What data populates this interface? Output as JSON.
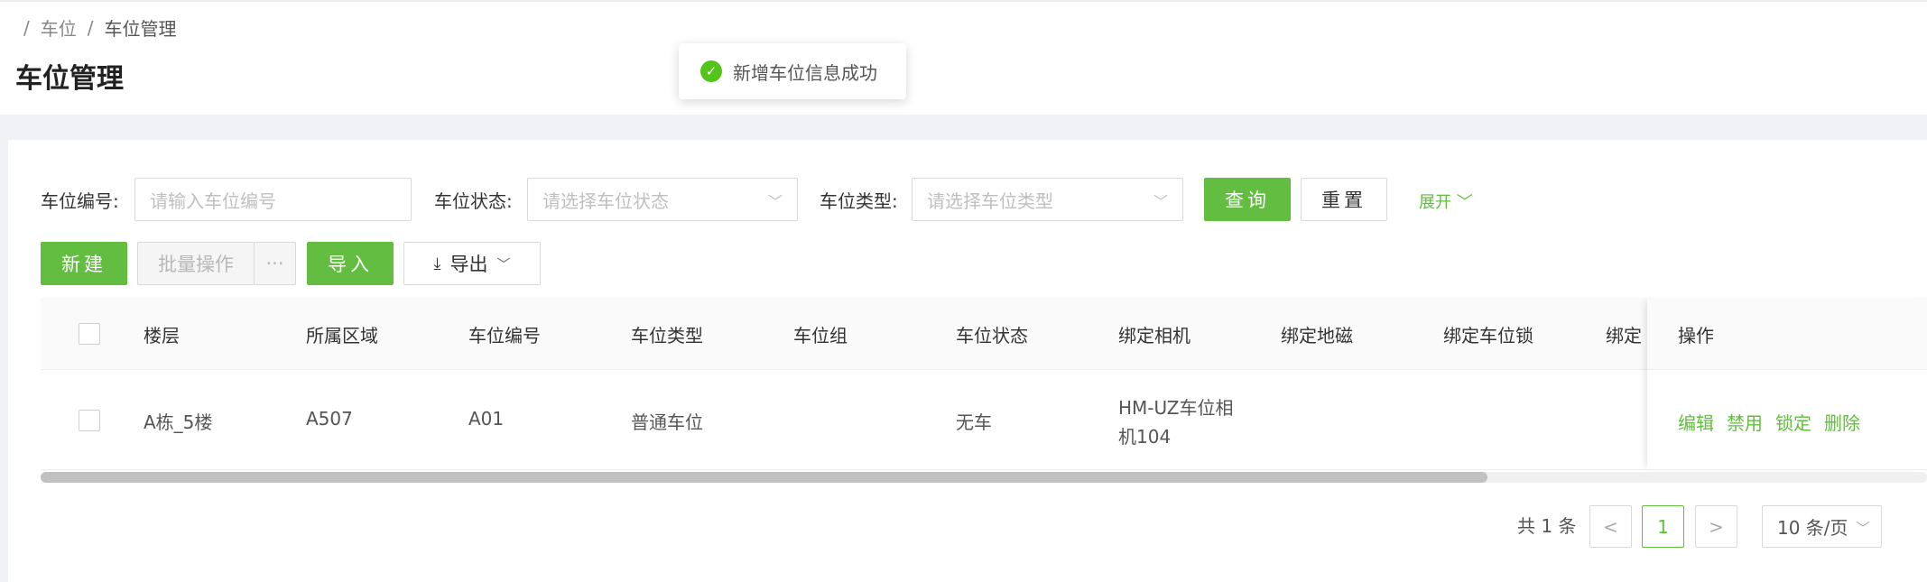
{
  "breadcrumb": {
    "sep": "/",
    "items": [
      "车位",
      "车位管理"
    ]
  },
  "page_title": "车位管理",
  "toast": {
    "message": "新增车位信息成功",
    "icon": "check-circle-icon"
  },
  "filters": {
    "spot_no": {
      "label": "车位编号:",
      "placeholder": "请输入车位编号"
    },
    "status": {
      "label": "车位状态:",
      "placeholder": "请选择车位状态"
    },
    "type": {
      "label": "车位类型:",
      "placeholder": "请选择车位类型"
    },
    "query_label": "查询",
    "reset_label": "重置",
    "expand_label": "展开"
  },
  "toolbar": {
    "new_label": "新建",
    "batch_label": "批量操作",
    "more_label": "···",
    "import_label": "导入",
    "export_label": "导出"
  },
  "table": {
    "columns": [
      "楼层",
      "所属区域",
      "车位编号",
      "车位类型",
      "车位组",
      "车位状态",
      "绑定相机",
      "绑定地磁",
      "绑定车位锁",
      "绑定",
      "操作"
    ],
    "rows": [
      {
        "floor": "A栋_5楼",
        "area": "A507",
        "spot_no": "A01",
        "type": "普通车位",
        "group": "",
        "status": "无车",
        "camera_line1": "HM-UZ车位相",
        "camera_line2": "机104",
        "magnet": "",
        "lock": ""
      }
    ],
    "actions": [
      "编辑",
      "禁用",
      "锁定",
      "删除"
    ]
  },
  "pagination": {
    "total": "共 1 条",
    "prev": "<",
    "current": "1",
    "next": ">",
    "page_size": "10 条/页"
  },
  "colors": {
    "primary": "#62bd40",
    "success": "#52c41a"
  }
}
